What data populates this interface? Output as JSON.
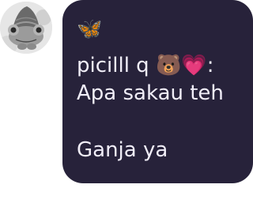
{
  "message": {
    "line1": "🦋",
    "line2": "picilll q 🐻💗:",
    "line3": "Apa sakau teh",
    "line4": "Ganja ya"
  },
  "colors": {
    "bubble_bg": "#27223a",
    "text": "#f1eef8",
    "page_bg": "#ffffff"
  },
  "icons": {
    "avatar": "frog-with-hat-avatar"
  }
}
